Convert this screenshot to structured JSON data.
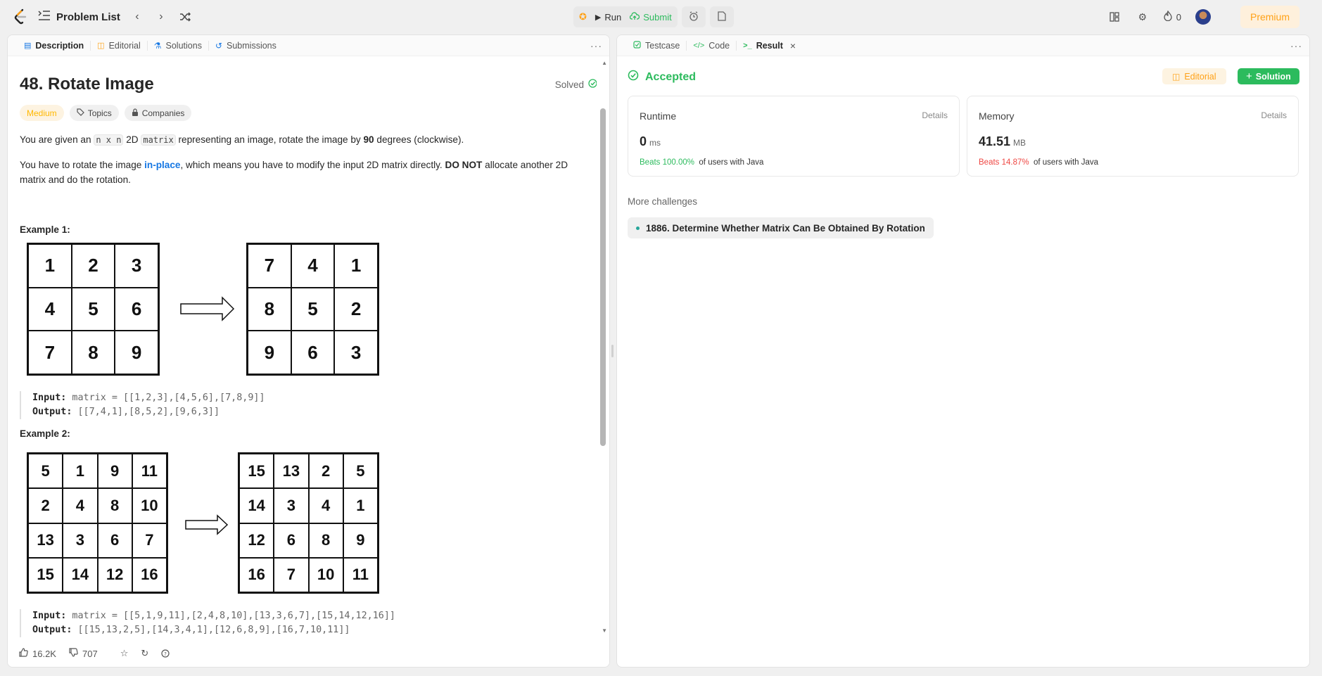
{
  "topbar": {
    "problem_list": "Problem List",
    "run": "Run",
    "submit": "Submit",
    "streak": "0",
    "premium": "Premium"
  },
  "left_tabs": [
    {
      "label": "Description",
      "icon": "description-icon",
      "color": "#1677e3"
    },
    {
      "label": "Editorial",
      "icon": "book-icon",
      "color": "#ffa116"
    },
    {
      "label": "Solutions",
      "icon": "flask-icon",
      "color": "#1677e3"
    },
    {
      "label": "Submissions",
      "icon": "history-icon",
      "color": "#1677e3"
    }
  ],
  "problem": {
    "title": "48. Rotate Image",
    "status": "Solved",
    "difficulty": "Medium",
    "topics": "Topics",
    "companies": "Companies",
    "p1": {
      "a": "You are given an ",
      "code1": "n x n",
      "b": " 2D ",
      "code2": "matrix",
      "c": " representing an image, rotate the image by ",
      "bold": "90",
      "d": " degrees (clockwise)."
    },
    "p2": {
      "a": "You have to rotate the image ",
      "link": "in-place",
      "b": ", which means you have to modify the input 2D matrix directly. ",
      "bold": "DO NOT",
      "c": " allocate another 2D matrix and do the rotation."
    },
    "example1": {
      "title": "Example 1:",
      "input_grid": [
        "1",
        "2",
        "3",
        "4",
        "5",
        "6",
        "7",
        "8",
        "9"
      ],
      "output_grid": [
        "7",
        "4",
        "1",
        "8",
        "5",
        "2",
        "9",
        "6",
        "3"
      ],
      "input_label": "Input:",
      "input_value": " matrix = [[1,2,3],[4,5,6],[7,8,9]]",
      "output_label": "Output:",
      "output_value": " [[7,4,1],[8,5,2],[9,6,3]]"
    },
    "example2": {
      "title": "Example 2:",
      "input_grid": [
        "5",
        "1",
        "9",
        "11",
        "2",
        "4",
        "8",
        "10",
        "13",
        "3",
        "6",
        "7",
        "15",
        "14",
        "12",
        "16"
      ],
      "output_grid": [
        "15",
        "13",
        "2",
        "5",
        "14",
        "3",
        "4",
        "1",
        "12",
        "6",
        "8",
        "9",
        "16",
        "7",
        "10",
        "11"
      ],
      "input_label": "Input:",
      "input_value": " matrix = [[5,1,9,11],[2,4,8,10],[13,3,6,7],[15,14,12,16]]",
      "output_label": "Output:",
      "output_value": " [[15,13,2,5],[14,3,4,1],[12,6,8,9],[16,7,10,11]]"
    }
  },
  "footer": {
    "likes": "16.2K",
    "dislikes": "707"
  },
  "right_tabs": [
    {
      "label": "Testcase",
      "icon": "checkbox-icon"
    },
    {
      "label": "Code",
      "icon": "code-icon"
    },
    {
      "label": "Result",
      "icon": "terminal-icon"
    }
  ],
  "result": {
    "status": "Accepted",
    "editorial_btn": "Editorial",
    "solution_btn": "Solution",
    "runtime": {
      "title": "Runtime",
      "details": "Details",
      "value": "0",
      "unit": "ms",
      "beats": "Beats 100.00%",
      "suffix": "of users with Java"
    },
    "memory": {
      "title": "Memory",
      "details": "Details",
      "value": "41.51",
      "unit": "MB",
      "beats": "Beats 14.87%",
      "suffix": "of users with Java"
    },
    "more_challenges": "More challenges",
    "challenge": "1886. Determine Whether Matrix Can Be Obtained By Rotation"
  },
  "colors": {
    "accent_green": "#2cbb5d",
    "accent_orange": "#ffa116",
    "link_blue": "#1677e3",
    "red": "#ef4743"
  }
}
